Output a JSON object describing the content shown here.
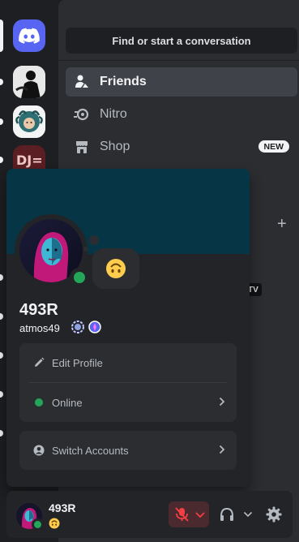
{
  "search": {
    "label": "Find or start a conversation"
  },
  "nav": {
    "friends": "Friends",
    "nitro": "Nitro",
    "shop": "Shop",
    "shop_badge": "NEW"
  },
  "dm_badge": "TV",
  "add_dm_symbol": "+",
  "servers": [
    "home-discord",
    "server-silhouette",
    "server-medusa-art",
    "server-dj"
  ],
  "profile": {
    "display_name": "493R",
    "username": "atmos49",
    "custom_status_emoji": "upside-down-face",
    "menu": {
      "edit_profile": "Edit Profile",
      "status": "Online",
      "switch_accounts": "Switch Accounts"
    }
  },
  "user_panel": {
    "name": "493R",
    "status_emoji": "upside-down-face"
  },
  "colors": {
    "banner": "#063546",
    "online": "#23a55a",
    "blurple": "#5865f2",
    "mute_red": "#f23f43"
  }
}
